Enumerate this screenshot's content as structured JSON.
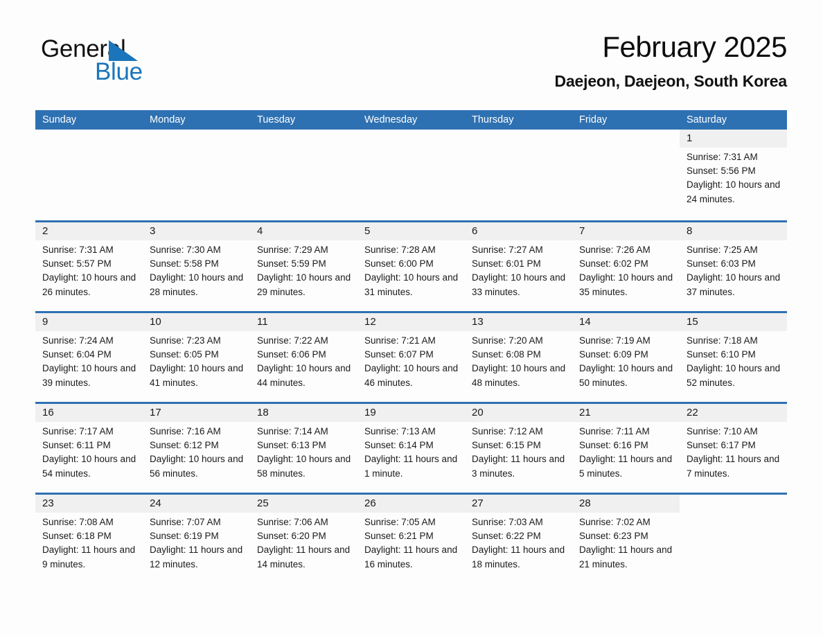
{
  "brand": {
    "name_dark": "General",
    "name_light": "Blue"
  },
  "header": {
    "title": "February 2025",
    "subtitle": "Daejeon, Daejeon, South Korea"
  },
  "colors": {
    "accent_blue": "#2e71b2",
    "brand_blue": "#1b75bb",
    "daynum_band": "#f0f0f0",
    "page_background": "#fdfdfd",
    "text": "#1a1a1a"
  },
  "weekdays": [
    "Sunday",
    "Monday",
    "Tuesday",
    "Wednesday",
    "Thursday",
    "Friday",
    "Saturday"
  ],
  "weeks": [
    [
      {
        "day": "",
        "sunrise": "",
        "sunset": "",
        "daylight": "",
        "blank": true
      },
      {
        "day": "",
        "sunrise": "",
        "sunset": "",
        "daylight": "",
        "blank": true
      },
      {
        "day": "",
        "sunrise": "",
        "sunset": "",
        "daylight": "",
        "blank": true
      },
      {
        "day": "",
        "sunrise": "",
        "sunset": "",
        "daylight": "",
        "blank": true
      },
      {
        "day": "",
        "sunrise": "",
        "sunset": "",
        "daylight": "",
        "blank": true
      },
      {
        "day": "",
        "sunrise": "",
        "sunset": "",
        "daylight": "",
        "blank": true
      },
      {
        "day": "1",
        "sunrise": "Sunrise: 7:31 AM",
        "sunset": "Sunset: 5:56 PM",
        "daylight": "Daylight: 10 hours and 24 minutes."
      }
    ],
    [
      {
        "day": "2",
        "sunrise": "Sunrise: 7:31 AM",
        "sunset": "Sunset: 5:57 PM",
        "daylight": "Daylight: 10 hours and 26 minutes."
      },
      {
        "day": "3",
        "sunrise": "Sunrise: 7:30 AM",
        "sunset": "Sunset: 5:58 PM",
        "daylight": "Daylight: 10 hours and 28 minutes."
      },
      {
        "day": "4",
        "sunrise": "Sunrise: 7:29 AM",
        "sunset": "Sunset: 5:59 PM",
        "daylight": "Daylight: 10 hours and 29 minutes."
      },
      {
        "day": "5",
        "sunrise": "Sunrise: 7:28 AM",
        "sunset": "Sunset: 6:00 PM",
        "daylight": "Daylight: 10 hours and 31 minutes."
      },
      {
        "day": "6",
        "sunrise": "Sunrise: 7:27 AM",
        "sunset": "Sunset: 6:01 PM",
        "daylight": "Daylight: 10 hours and 33 minutes."
      },
      {
        "day": "7",
        "sunrise": "Sunrise: 7:26 AM",
        "sunset": "Sunset: 6:02 PM",
        "daylight": "Daylight: 10 hours and 35 minutes."
      },
      {
        "day": "8",
        "sunrise": "Sunrise: 7:25 AM",
        "sunset": "Sunset: 6:03 PM",
        "daylight": "Daylight: 10 hours and 37 minutes."
      }
    ],
    [
      {
        "day": "9",
        "sunrise": "Sunrise: 7:24 AM",
        "sunset": "Sunset: 6:04 PM",
        "daylight": "Daylight: 10 hours and 39 minutes."
      },
      {
        "day": "10",
        "sunrise": "Sunrise: 7:23 AM",
        "sunset": "Sunset: 6:05 PM",
        "daylight": "Daylight: 10 hours and 41 minutes."
      },
      {
        "day": "11",
        "sunrise": "Sunrise: 7:22 AM",
        "sunset": "Sunset: 6:06 PM",
        "daylight": "Daylight: 10 hours and 44 minutes."
      },
      {
        "day": "12",
        "sunrise": "Sunrise: 7:21 AM",
        "sunset": "Sunset: 6:07 PM",
        "daylight": "Daylight: 10 hours and 46 minutes."
      },
      {
        "day": "13",
        "sunrise": "Sunrise: 7:20 AM",
        "sunset": "Sunset: 6:08 PM",
        "daylight": "Daylight: 10 hours and 48 minutes."
      },
      {
        "day": "14",
        "sunrise": "Sunrise: 7:19 AM",
        "sunset": "Sunset: 6:09 PM",
        "daylight": "Daylight: 10 hours and 50 minutes."
      },
      {
        "day": "15",
        "sunrise": "Sunrise: 7:18 AM",
        "sunset": "Sunset: 6:10 PM",
        "daylight": "Daylight: 10 hours and 52 minutes."
      }
    ],
    [
      {
        "day": "16",
        "sunrise": "Sunrise: 7:17 AM",
        "sunset": "Sunset: 6:11 PM",
        "daylight": "Daylight: 10 hours and 54 minutes."
      },
      {
        "day": "17",
        "sunrise": "Sunrise: 7:16 AM",
        "sunset": "Sunset: 6:12 PM",
        "daylight": "Daylight: 10 hours and 56 minutes."
      },
      {
        "day": "18",
        "sunrise": "Sunrise: 7:14 AM",
        "sunset": "Sunset: 6:13 PM",
        "daylight": "Daylight: 10 hours and 58 minutes."
      },
      {
        "day": "19",
        "sunrise": "Sunrise: 7:13 AM",
        "sunset": "Sunset: 6:14 PM",
        "daylight": "Daylight: 11 hours and 1 minute."
      },
      {
        "day": "20",
        "sunrise": "Sunrise: 7:12 AM",
        "sunset": "Sunset: 6:15 PM",
        "daylight": "Daylight: 11 hours and 3 minutes."
      },
      {
        "day": "21",
        "sunrise": "Sunrise: 7:11 AM",
        "sunset": "Sunset: 6:16 PM",
        "daylight": "Daylight: 11 hours and 5 minutes."
      },
      {
        "day": "22",
        "sunrise": "Sunrise: 7:10 AM",
        "sunset": "Sunset: 6:17 PM",
        "daylight": "Daylight: 11 hours and 7 minutes."
      }
    ],
    [
      {
        "day": "23",
        "sunrise": "Sunrise: 7:08 AM",
        "sunset": "Sunset: 6:18 PM",
        "daylight": "Daylight: 11 hours and 9 minutes."
      },
      {
        "day": "24",
        "sunrise": "Sunrise: 7:07 AM",
        "sunset": "Sunset: 6:19 PM",
        "daylight": "Daylight: 11 hours and 12 minutes."
      },
      {
        "day": "25",
        "sunrise": "Sunrise: 7:06 AM",
        "sunset": "Sunset: 6:20 PM",
        "daylight": "Daylight: 11 hours and 14 minutes."
      },
      {
        "day": "26",
        "sunrise": "Sunrise: 7:05 AM",
        "sunset": "Sunset: 6:21 PM",
        "daylight": "Daylight: 11 hours and 16 minutes."
      },
      {
        "day": "27",
        "sunrise": "Sunrise: 7:03 AM",
        "sunset": "Sunset: 6:22 PM",
        "daylight": "Daylight: 11 hours and 18 minutes."
      },
      {
        "day": "28",
        "sunrise": "Sunrise: 7:02 AM",
        "sunset": "Sunset: 6:23 PM",
        "daylight": "Daylight: 11 hours and 21 minutes."
      },
      {
        "day": "",
        "sunrise": "",
        "sunset": "",
        "daylight": "",
        "blank": true
      }
    ]
  ]
}
